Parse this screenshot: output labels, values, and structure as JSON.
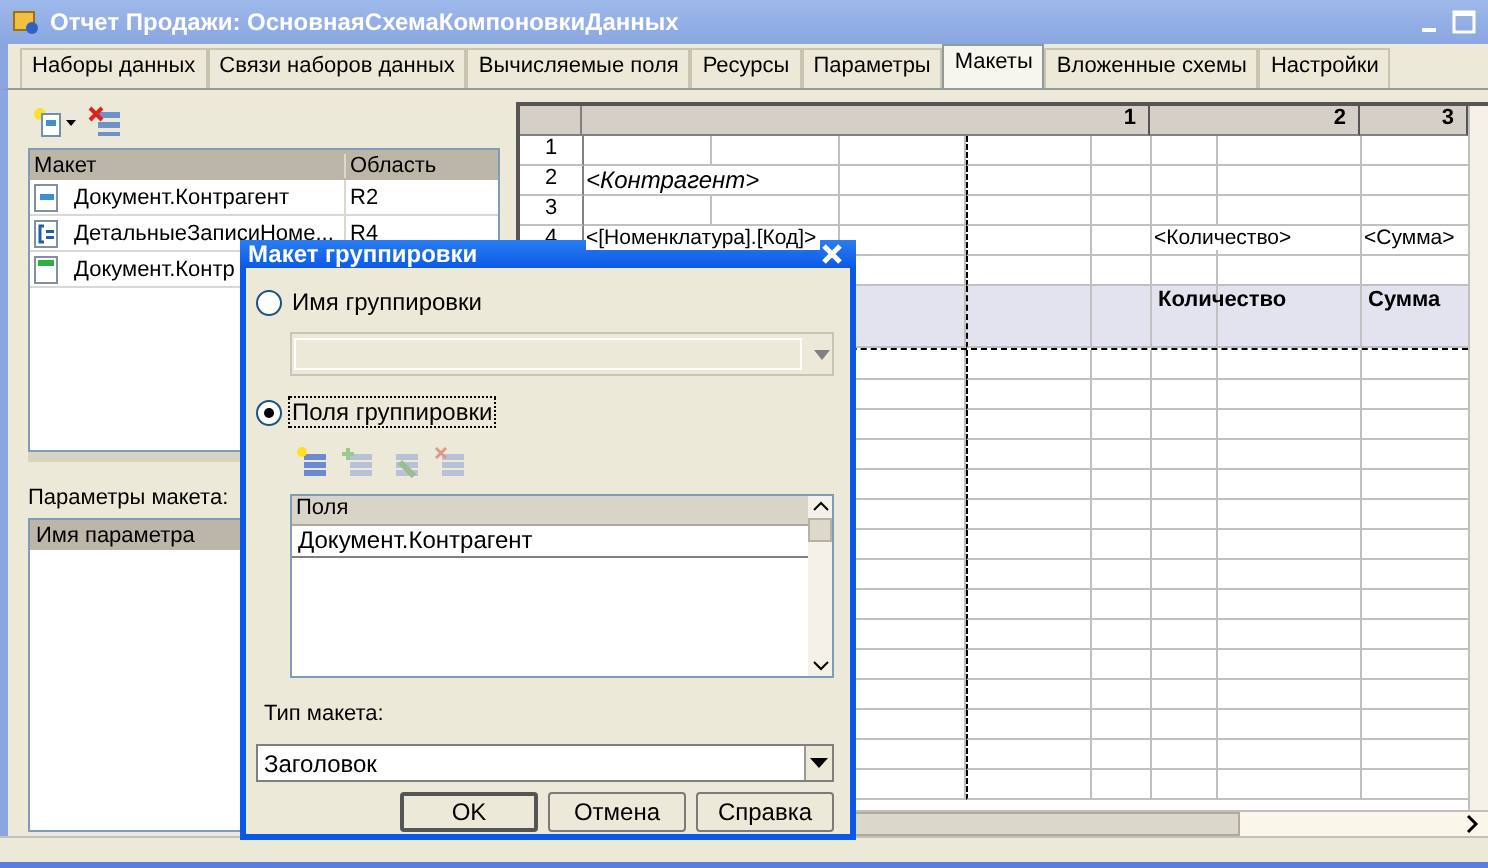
{
  "window": {
    "title": "Отчет Продажи: ОсновнаяСхемаКомпоновкиДанных"
  },
  "tabs": [
    {
      "label": "Наборы данных",
      "selected": false
    },
    {
      "label": "Связи наборов данных",
      "selected": false
    },
    {
      "label": "Вычисляемые поля",
      "selected": false
    },
    {
      "label": "Ресурсы",
      "selected": false
    },
    {
      "label": "Параметры",
      "selected": false
    },
    {
      "label": "Макеты",
      "selected": true
    },
    {
      "label": "Вложенные схемы",
      "selected": false
    },
    {
      "label": "Настройки",
      "selected": false
    }
  ],
  "templates": {
    "columns": [
      "Макет",
      "Область"
    ],
    "rows": [
      {
        "kind": "group",
        "name": "Документ.Контрагент",
        "area": "R2"
      },
      {
        "kind": "detail",
        "name": "ДетальныеЗаписиНоме...",
        "area": "R4"
      },
      {
        "kind": "header",
        "name": "Документ.Контр"
      }
    ]
  },
  "parameters": {
    "label": "Параметры макета:",
    "columns": [
      "Имя параметра"
    ]
  },
  "sheet": {
    "column_headers": [
      "1",
      "2",
      "3"
    ],
    "rows": [
      {
        "kind": "data",
        "number": "1"
      },
      {
        "kind": "data",
        "number": "2",
        "col1": "<Контрагент>",
        "italic": true
      },
      {
        "kind": "data",
        "number": "3"
      },
      {
        "kind": "data",
        "number": "4",
        "col1": "<[Номенклатура].[Код]>",
        "col2": "<Количество>",
        "col3": "<Сумма>"
      },
      {
        "kind": "data"
      },
      {
        "kind": "header",
        "col2": "Количество",
        "col3": "Сумма"
      }
    ]
  },
  "dialog": {
    "title": "Макет группировки",
    "options": [
      {
        "label": "Имя группировки",
        "selected": false
      },
      {
        "label": "Поля группировки",
        "selected": true
      }
    ],
    "fields_toolbar": [
      {
        "kind": "add",
        "disabled": false
      },
      {
        "kind": "add_child",
        "disabled": true
      },
      {
        "kind": "edit",
        "disabled": true
      },
      {
        "kind": "delete",
        "disabled": true
      }
    ],
    "fields_list": {
      "column": "Поля",
      "rows": [
        "Документ.Контрагент"
      ]
    },
    "type_label": "Тип макета:",
    "type_value": "Заголовок",
    "buttons": [
      "OK",
      "Отмена",
      "Справка"
    ]
  }
}
